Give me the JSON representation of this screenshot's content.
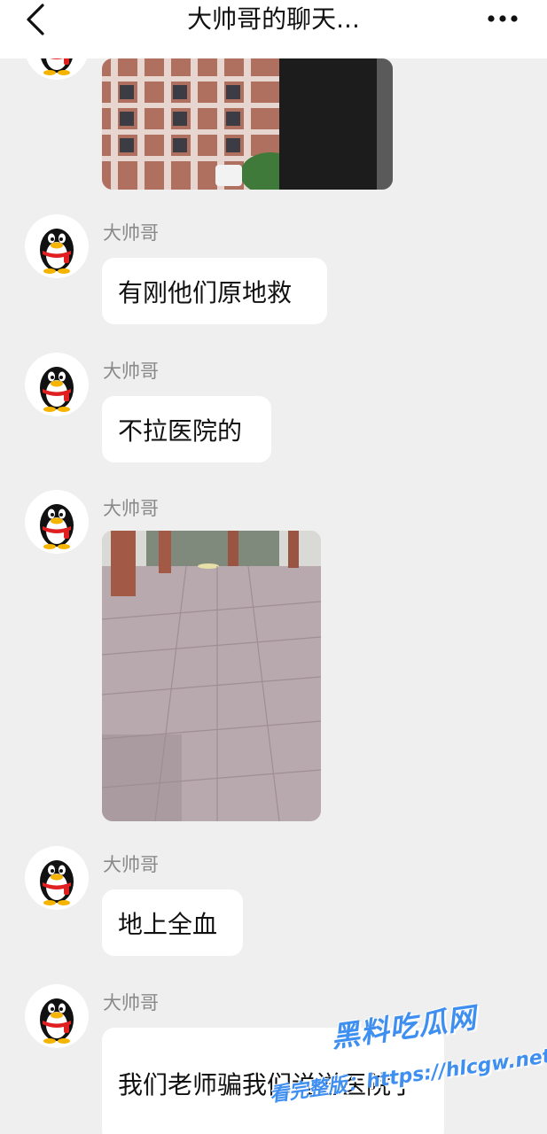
{
  "header": {
    "title": "大帅哥的聊天...",
    "back_icon": "chevron-left-icon",
    "more_icon": "more-dots-icon"
  },
  "colors": {
    "background": "#efefef",
    "bubble": "#ffffff",
    "sender_name": "#8a8a8a",
    "watermark": "#3f8ff0"
  },
  "messages": [
    {
      "type": "image",
      "image_desc": "school-building-photo"
    },
    {
      "type": "text",
      "sender": "大帅哥",
      "text": "有刚他们原地救"
    },
    {
      "type": "text",
      "sender": "大帅哥",
      "text": "不拉医院的"
    },
    {
      "type": "image",
      "sender": "大帅哥",
      "image_desc": "tiled-ground-photo"
    },
    {
      "type": "text",
      "sender": "大帅哥",
      "text": "地上全血"
    },
    {
      "type": "text",
      "sender": "大帅哥",
      "text": "我们老师骗我们说送医院了"
    }
  ],
  "watermark": {
    "line1": "黑料吃瓜网",
    "line2": "看完整版：https://hlcgw.net"
  }
}
